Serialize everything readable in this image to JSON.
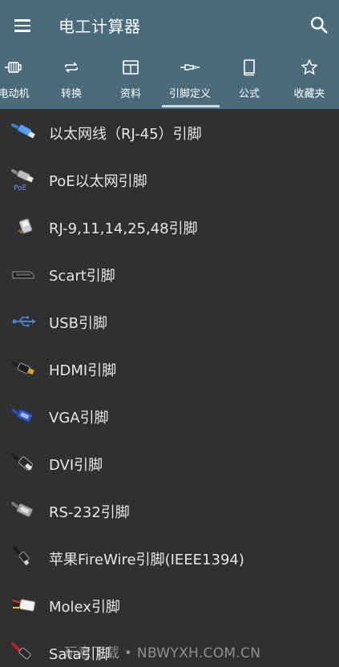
{
  "app": {
    "title": "电工计算器"
  },
  "appbar": {
    "menu_icon": "hamburger-menu-icon",
    "search_icon": "search-icon"
  },
  "tabs": [
    {
      "label": "电动机",
      "icon": "motor-icon"
    },
    {
      "label": "转换",
      "icon": "convert-icon"
    },
    {
      "label": "资料",
      "icon": "resources-icon"
    },
    {
      "label": "引脚定义",
      "icon": "connector-icon",
      "selected": true
    },
    {
      "label": "公式",
      "icon": "book-icon"
    },
    {
      "label": "收藏夹",
      "icon": "star-icon"
    }
  ],
  "list": [
    {
      "label": "以太网线（RJ-45）引脚",
      "icon": "ethernet-cable-icon"
    },
    {
      "label": "PoE以太网引脚",
      "icon": "poe-cable-icon"
    },
    {
      "label": "RJ-9,11,14,25,48引脚",
      "icon": "rj-connector-icon"
    },
    {
      "label": "Scart引脚",
      "icon": "scart-connector-icon"
    },
    {
      "label": "USB引脚",
      "icon": "usb-icon"
    },
    {
      "label": "HDMI引脚",
      "icon": "hdmi-connector-icon"
    },
    {
      "label": "VGA引脚",
      "icon": "vga-connector-icon"
    },
    {
      "label": "DVI引脚",
      "icon": "dvi-connector-icon"
    },
    {
      "label": "RS-232引脚",
      "icon": "rs232-connector-icon"
    },
    {
      "label": "苹果FireWire引脚(IEEE1394)",
      "icon": "firewire-connector-icon"
    },
    {
      "label": "Molex引脚",
      "icon": "molex-connector-icon"
    },
    {
      "label": "Sata引脚",
      "icon": "sata-connector-icon"
    }
  ],
  "watermark": "玩意下载 • NBWYXH.COM.CN",
  "colors": {
    "appbar": "#496b7a",
    "background": "#303030",
    "text": "#e6e6e6",
    "indicator": "#cfd9de"
  }
}
